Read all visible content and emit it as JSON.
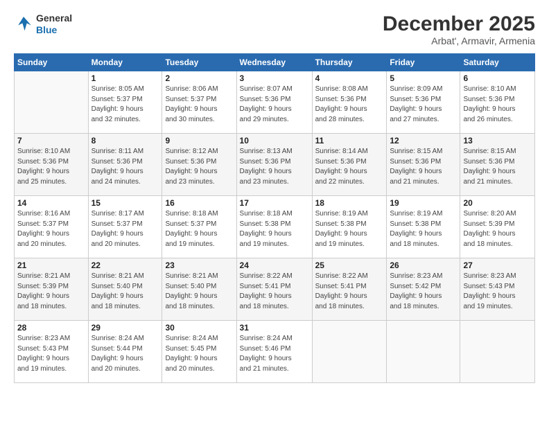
{
  "logo": {
    "line1": "General",
    "line2": "Blue"
  },
  "title": "December 2025",
  "subtitle": "Arbat', Armavir, Armenia",
  "header_days": [
    "Sunday",
    "Monday",
    "Tuesday",
    "Wednesday",
    "Thursday",
    "Friday",
    "Saturday"
  ],
  "weeks": [
    [
      {
        "day": "",
        "info": ""
      },
      {
        "day": "1",
        "info": "Sunrise: 8:05 AM\nSunset: 5:37 PM\nDaylight: 9 hours\nand 32 minutes."
      },
      {
        "day": "2",
        "info": "Sunrise: 8:06 AM\nSunset: 5:37 PM\nDaylight: 9 hours\nand 30 minutes."
      },
      {
        "day": "3",
        "info": "Sunrise: 8:07 AM\nSunset: 5:36 PM\nDaylight: 9 hours\nand 29 minutes."
      },
      {
        "day": "4",
        "info": "Sunrise: 8:08 AM\nSunset: 5:36 PM\nDaylight: 9 hours\nand 28 minutes."
      },
      {
        "day": "5",
        "info": "Sunrise: 8:09 AM\nSunset: 5:36 PM\nDaylight: 9 hours\nand 27 minutes."
      },
      {
        "day": "6",
        "info": "Sunrise: 8:10 AM\nSunset: 5:36 PM\nDaylight: 9 hours\nand 26 minutes."
      }
    ],
    [
      {
        "day": "7",
        "info": "Sunrise: 8:10 AM\nSunset: 5:36 PM\nDaylight: 9 hours\nand 25 minutes."
      },
      {
        "day": "8",
        "info": "Sunrise: 8:11 AM\nSunset: 5:36 PM\nDaylight: 9 hours\nand 24 minutes."
      },
      {
        "day": "9",
        "info": "Sunrise: 8:12 AM\nSunset: 5:36 PM\nDaylight: 9 hours\nand 23 minutes."
      },
      {
        "day": "10",
        "info": "Sunrise: 8:13 AM\nSunset: 5:36 PM\nDaylight: 9 hours\nand 23 minutes."
      },
      {
        "day": "11",
        "info": "Sunrise: 8:14 AM\nSunset: 5:36 PM\nDaylight: 9 hours\nand 22 minutes."
      },
      {
        "day": "12",
        "info": "Sunrise: 8:15 AM\nSunset: 5:36 PM\nDaylight: 9 hours\nand 21 minutes."
      },
      {
        "day": "13",
        "info": "Sunrise: 8:15 AM\nSunset: 5:36 PM\nDaylight: 9 hours\nand 21 minutes."
      }
    ],
    [
      {
        "day": "14",
        "info": "Sunrise: 8:16 AM\nSunset: 5:37 PM\nDaylight: 9 hours\nand 20 minutes."
      },
      {
        "day": "15",
        "info": "Sunrise: 8:17 AM\nSunset: 5:37 PM\nDaylight: 9 hours\nand 20 minutes."
      },
      {
        "day": "16",
        "info": "Sunrise: 8:18 AM\nSunset: 5:37 PM\nDaylight: 9 hours\nand 19 minutes."
      },
      {
        "day": "17",
        "info": "Sunrise: 8:18 AM\nSunset: 5:38 PM\nDaylight: 9 hours\nand 19 minutes."
      },
      {
        "day": "18",
        "info": "Sunrise: 8:19 AM\nSunset: 5:38 PM\nDaylight: 9 hours\nand 19 minutes."
      },
      {
        "day": "19",
        "info": "Sunrise: 8:19 AM\nSunset: 5:38 PM\nDaylight: 9 hours\nand 18 minutes."
      },
      {
        "day": "20",
        "info": "Sunrise: 8:20 AM\nSunset: 5:39 PM\nDaylight: 9 hours\nand 18 minutes."
      }
    ],
    [
      {
        "day": "21",
        "info": "Sunrise: 8:21 AM\nSunset: 5:39 PM\nDaylight: 9 hours\nand 18 minutes."
      },
      {
        "day": "22",
        "info": "Sunrise: 8:21 AM\nSunset: 5:40 PM\nDaylight: 9 hours\nand 18 minutes."
      },
      {
        "day": "23",
        "info": "Sunrise: 8:21 AM\nSunset: 5:40 PM\nDaylight: 9 hours\nand 18 minutes."
      },
      {
        "day": "24",
        "info": "Sunrise: 8:22 AM\nSunset: 5:41 PM\nDaylight: 9 hours\nand 18 minutes."
      },
      {
        "day": "25",
        "info": "Sunrise: 8:22 AM\nSunset: 5:41 PM\nDaylight: 9 hours\nand 18 minutes."
      },
      {
        "day": "26",
        "info": "Sunrise: 8:23 AM\nSunset: 5:42 PM\nDaylight: 9 hours\nand 18 minutes."
      },
      {
        "day": "27",
        "info": "Sunrise: 8:23 AM\nSunset: 5:43 PM\nDaylight: 9 hours\nand 19 minutes."
      }
    ],
    [
      {
        "day": "28",
        "info": "Sunrise: 8:23 AM\nSunset: 5:43 PM\nDaylight: 9 hours\nand 19 minutes."
      },
      {
        "day": "29",
        "info": "Sunrise: 8:24 AM\nSunset: 5:44 PM\nDaylight: 9 hours\nand 20 minutes."
      },
      {
        "day": "30",
        "info": "Sunrise: 8:24 AM\nSunset: 5:45 PM\nDaylight: 9 hours\nand 20 minutes."
      },
      {
        "day": "31",
        "info": "Sunrise: 8:24 AM\nSunset: 5:46 PM\nDaylight: 9 hours\nand 21 minutes."
      },
      {
        "day": "",
        "info": ""
      },
      {
        "day": "",
        "info": ""
      },
      {
        "day": "",
        "info": ""
      }
    ]
  ]
}
